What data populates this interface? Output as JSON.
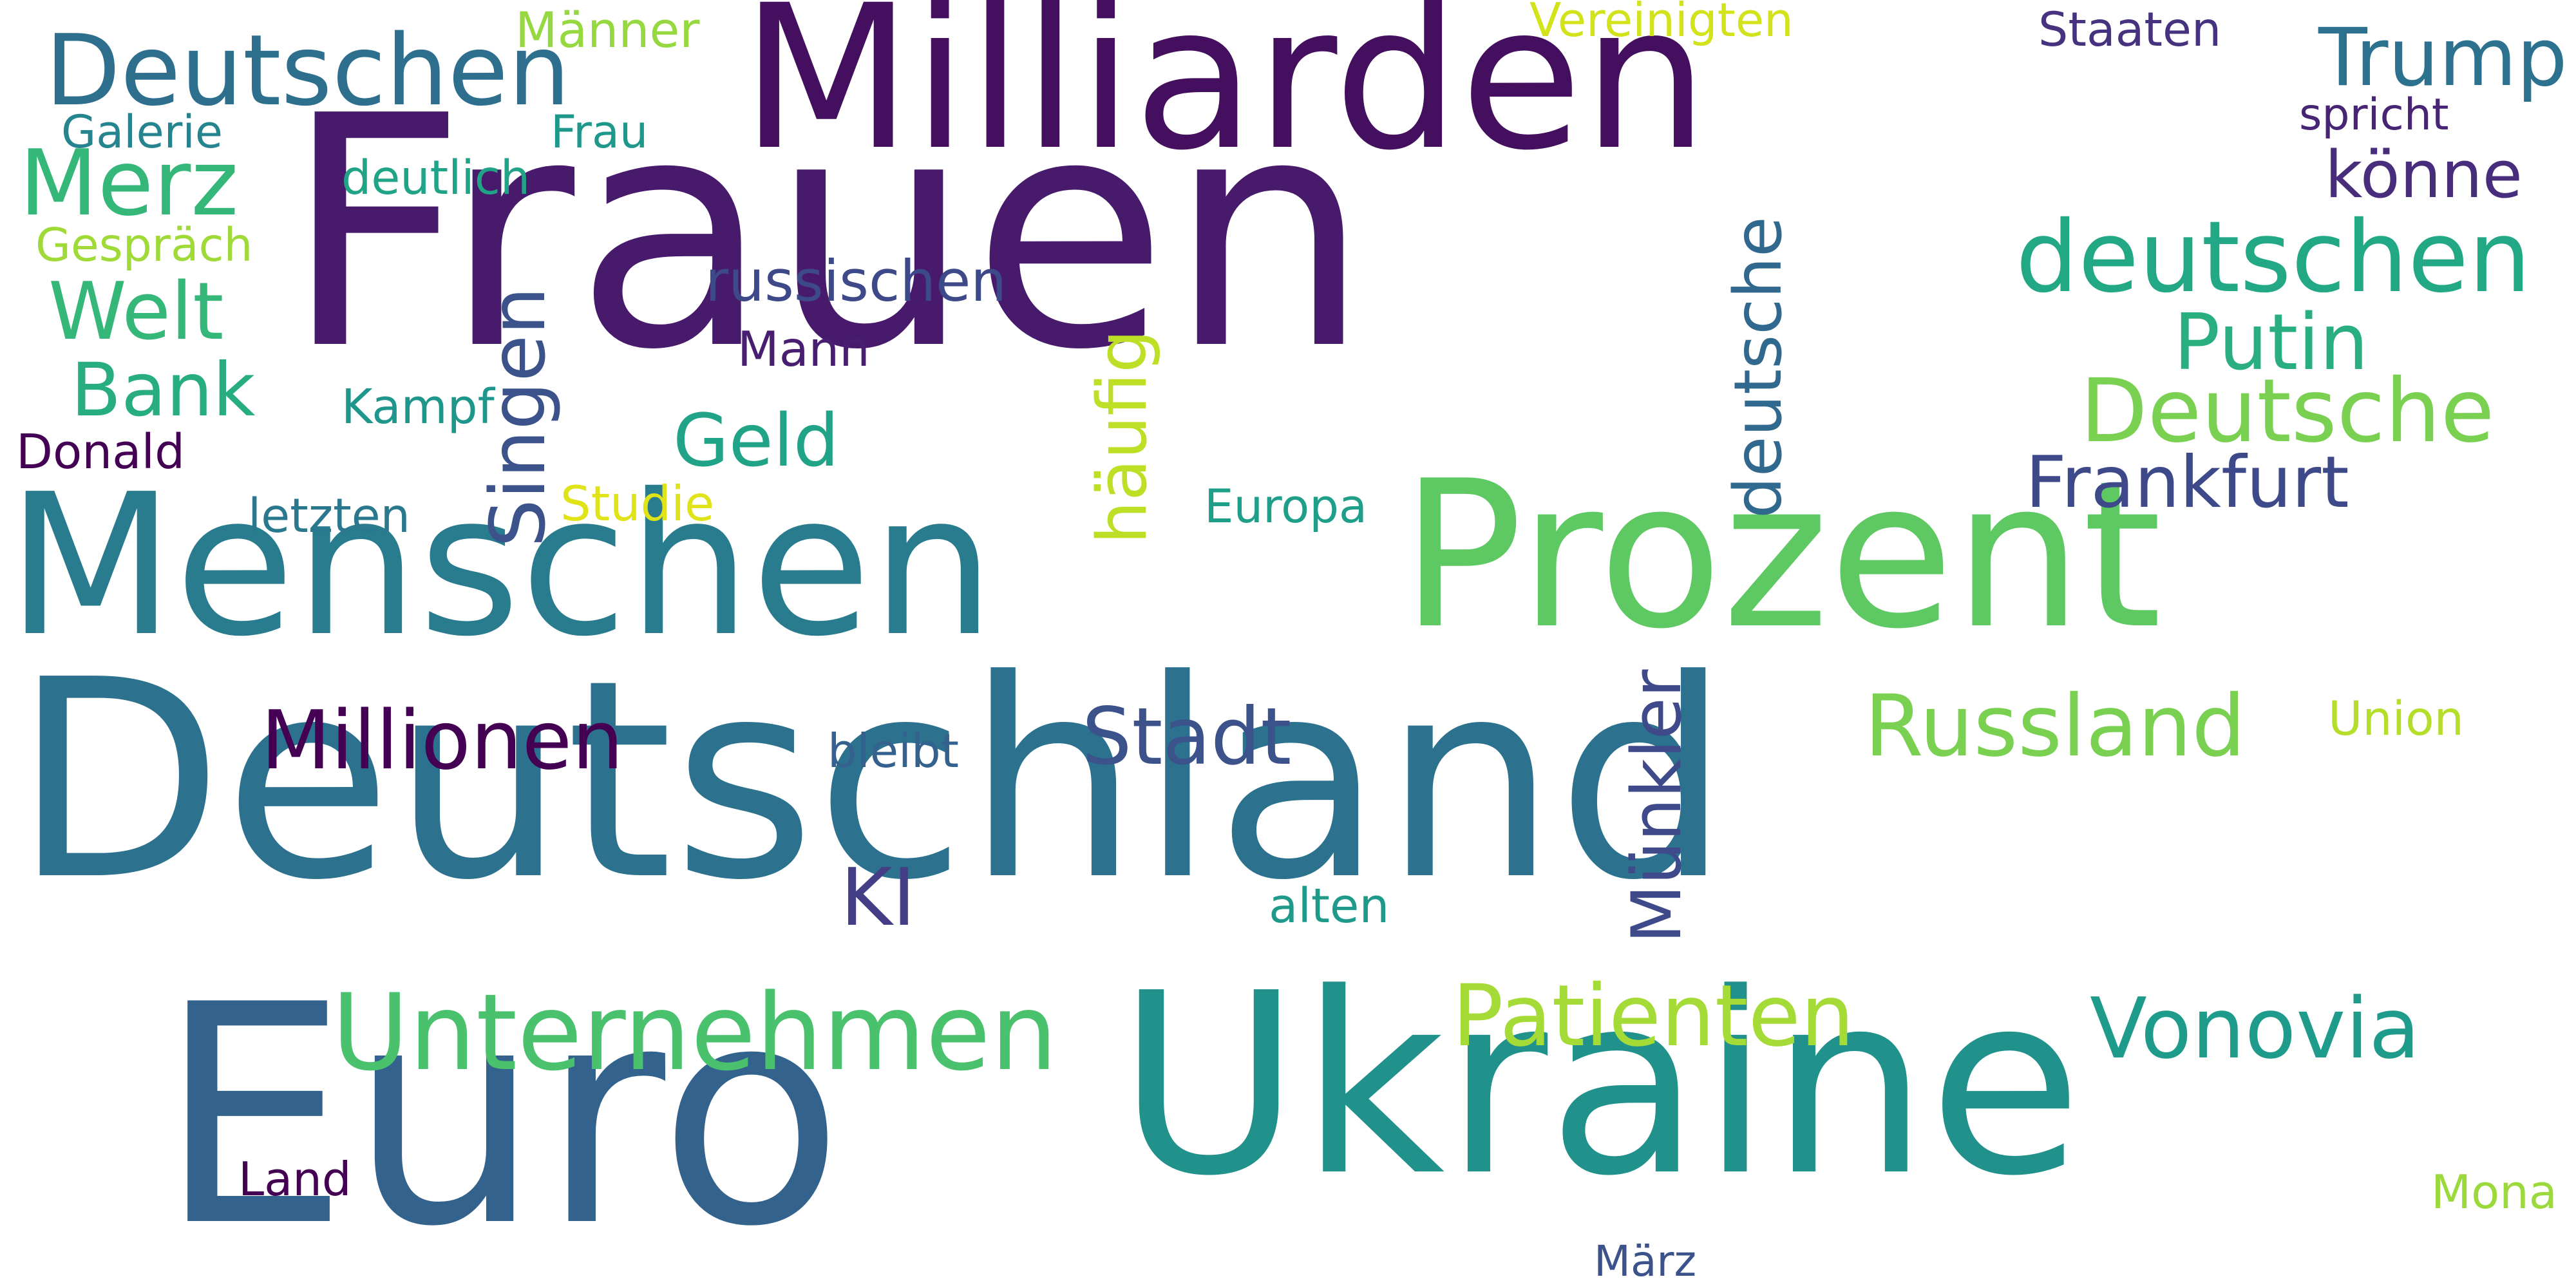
{
  "words": [
    {
      "id": "w0",
      "name": "word-deutschland",
      "text": "Deutschland",
      "color": "#2c728e"
    },
    {
      "id": "w1",
      "name": "word-frauen",
      "text": "Frauen",
      "color": "#481a6c"
    },
    {
      "id": "w2",
      "name": "word-euro",
      "text": "Euro",
      "color": "#33638d"
    },
    {
      "id": "w3",
      "name": "word-ukraine",
      "text": "Ukraine",
      "color": "#21918c"
    },
    {
      "id": "w4",
      "name": "word-menschen",
      "text": "Menschen",
      "color": "#287c8e"
    },
    {
      "id": "w5",
      "name": "word-prozent",
      "text": "Prozent",
      "color": "#5ec962"
    },
    {
      "id": "w6",
      "name": "word-milliarden",
      "text": "Milliarden",
      "color": "#440f5e"
    },
    {
      "id": "w7",
      "name": "word-unternehmen",
      "text": "Unternehmen",
      "color": "#4ac16d"
    },
    {
      "id": "w8",
      "name": "word-deutschen-upper",
      "text": "Deutschen",
      "color": "#2e6f8e"
    },
    {
      "id": "w9",
      "name": "word-deutschen-lower",
      "text": "deutschen",
      "color": "#22a884"
    },
    {
      "id": "w10",
      "name": "word-deutsche-lower",
      "text": "deutsche",
      "color": "#31688e"
    },
    {
      "id": "w11",
      "name": "word-deutsche-upper",
      "text": "Deutsche",
      "color": "#7ad151"
    },
    {
      "id": "w12",
      "name": "word-patienten",
      "text": "Patienten",
      "color": "#a5db36"
    },
    {
      "id": "w13",
      "name": "word-russland",
      "text": "Russland",
      "color": "#7ad151"
    },
    {
      "id": "w14",
      "name": "word-vonovia",
      "text": "Vonovia",
      "color": "#1e9b8a"
    },
    {
      "id": "w15",
      "name": "word-millionen",
      "text": "Millionen",
      "color": "#440154"
    },
    {
      "id": "w16",
      "name": "word-singen",
      "text": "Singen",
      "color": "#3b528b"
    },
    {
      "id": "w17",
      "name": "word-muenkler",
      "text": "Münkler",
      "color": "#3e4a89"
    },
    {
      "id": "w18",
      "name": "word-stadt",
      "text": "Stadt",
      "color": "#3b528b"
    },
    {
      "id": "w19",
      "name": "word-trump",
      "text": "Trump",
      "color": "#2c728e"
    },
    {
      "id": "w20",
      "name": "word-merz",
      "text": "Merz",
      "color": "#35b779"
    },
    {
      "id": "w21",
      "name": "word-putin",
      "text": "Putin",
      "color": "#29af7f"
    },
    {
      "id": "w22",
      "name": "word-frankfurt",
      "text": "Frankfurt",
      "color": "#3e4989"
    },
    {
      "id": "w23",
      "name": "word-welt",
      "text": "Welt",
      "color": "#35b779"
    },
    {
      "id": "w24",
      "name": "word-bank",
      "text": "Bank",
      "color": "#27ad81"
    },
    {
      "id": "w25",
      "name": "word-geld",
      "text": "Geld",
      "color": "#20a386"
    },
    {
      "id": "w26",
      "name": "word-haeufig",
      "text": "häufig",
      "color": "#bddf26"
    },
    {
      "id": "w27",
      "name": "word-koenne",
      "text": "könne",
      "color": "#472d7b"
    },
    {
      "id": "w28",
      "name": "word-ki",
      "text": "KI",
      "color": "#433e85"
    },
    {
      "id": "w29",
      "name": "word-russischen",
      "text": "russischen",
      "color": "#3e4989"
    },
    {
      "id": "w30",
      "name": "word-maenner",
      "text": "Männer",
      "color": "#95d840"
    },
    {
      "id": "w31",
      "name": "word-vereinigten",
      "text": "Vereinigten",
      "color": "#d2e21b"
    },
    {
      "id": "w32",
      "name": "word-staaten",
      "text": "Staaten",
      "color": "#46327e"
    },
    {
      "id": "w33",
      "name": "word-spricht",
      "text": "spricht",
      "color": "#482475"
    },
    {
      "id": "w34",
      "name": "word-galerie",
      "text": "Galerie",
      "color": "#25848e"
    },
    {
      "id": "w35",
      "name": "word-frau",
      "text": "Frau",
      "color": "#1f988b"
    },
    {
      "id": "w36",
      "name": "word-deutlich",
      "text": "deutlich",
      "color": "#20a386"
    },
    {
      "id": "w37",
      "name": "word-gespraech",
      "text": "Gespräch",
      "color": "#a0da39"
    },
    {
      "id": "w38",
      "name": "word-mann",
      "text": "Mann",
      "color": "#481f70"
    },
    {
      "id": "w39",
      "name": "word-kampf",
      "text": "Kampf",
      "color": "#1f968b"
    },
    {
      "id": "w40",
      "name": "word-donald",
      "text": "Donald",
      "color": "#440154"
    },
    {
      "id": "w41",
      "name": "word-letzten",
      "text": "letzten",
      "color": "#2a788e"
    },
    {
      "id": "w42",
      "name": "word-studie",
      "text": "Studie",
      "color": "#dfe318"
    },
    {
      "id": "w43",
      "name": "word-europa",
      "text": "Europa",
      "color": "#1f9e89"
    },
    {
      "id": "w44",
      "name": "word-union",
      "text": "Union",
      "color": "#b5de2b"
    },
    {
      "id": "w45",
      "name": "word-bleibt",
      "text": "bleibt",
      "color": "#34618d"
    },
    {
      "id": "w46",
      "name": "word-alten",
      "text": "alten",
      "color": "#1f9a8a"
    },
    {
      "id": "w47",
      "name": "word-land",
      "text": "Land",
      "color": "#440154"
    },
    {
      "id": "w48",
      "name": "word-maerz",
      "text": "März",
      "color": "#3b528b"
    },
    {
      "id": "w49",
      "name": "word-mona",
      "text": "Mona",
      "color": "#9bd93c"
    }
  ]
}
